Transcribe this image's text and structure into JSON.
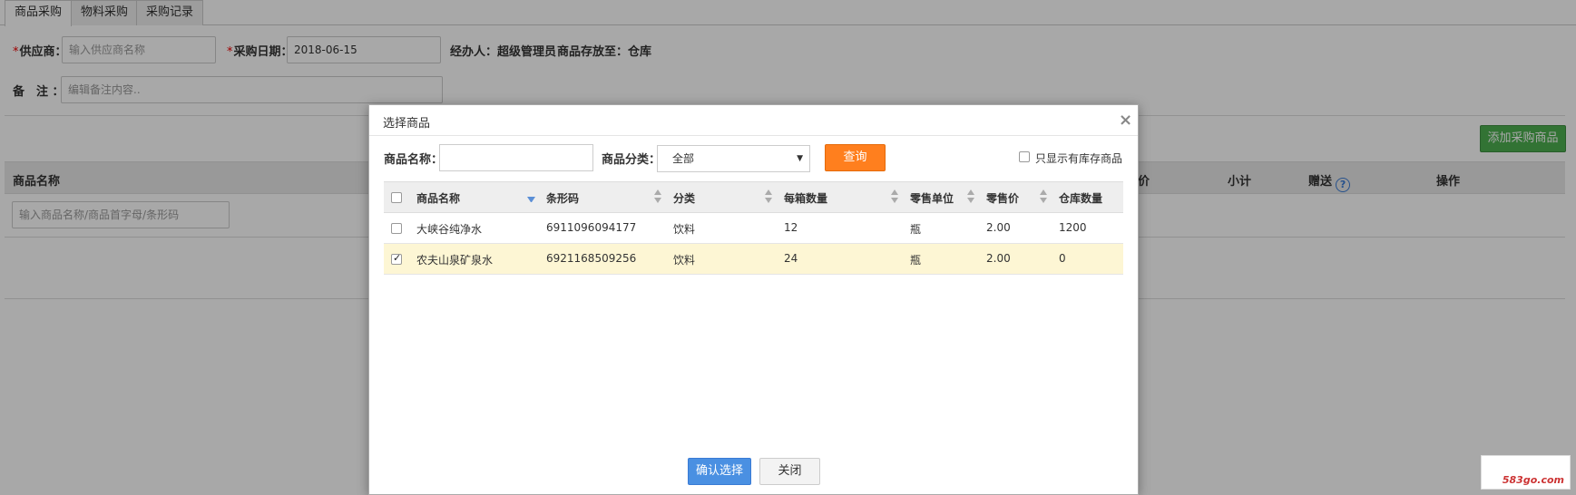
{
  "tabs": [
    "商品采购",
    "物料采购",
    "采购记录"
  ],
  "form": {
    "supplier_label": "供应商：",
    "supplier_placeholder": "输入供应商名称",
    "date_label": "采购日期：",
    "date_value": "2018-06-15",
    "handler": "经办人：超级管理员",
    "storage": "商品存放至：仓库",
    "remark_label": "备　注 ：",
    "remark_placeholder": "编辑备注内容.."
  },
  "add_button": "添加采购商品",
  "table": {
    "col_name": "商品名称",
    "col_price_partial": "价",
    "col_subtotal": "小计",
    "col_gift": "赠送",
    "col_action": "操作",
    "search_placeholder": "输入商品名称/商品首字母/条形码"
  },
  "modal": {
    "title": "选择商品",
    "close_glyph": "×",
    "name_label": "商品名称：",
    "category_label": "商品分类：",
    "category_value": "全部",
    "query_button": "查询",
    "stock_only_label": "只显示有库存商品",
    "columns": [
      "商品名称",
      "条形码",
      "分类",
      "每箱数量",
      "零售单位",
      "零售价",
      "仓库数量"
    ],
    "rows": [
      {
        "checked": false,
        "name": "大峡谷纯净水",
        "barcode": "6911096094177",
        "category": "饮料",
        "per_box": "12",
        "unit": "瓶",
        "price": "2.00",
        "stock": "1200"
      },
      {
        "checked": true,
        "name": "农夫山泉矿泉水",
        "barcode": "6921168509256",
        "category": "饮料",
        "per_box": "24",
        "unit": "瓶",
        "price": "2.00",
        "stock": "0"
      }
    ],
    "confirm_button": "确认选择",
    "close_button": "关闭"
  },
  "watermark": "583go.com"
}
